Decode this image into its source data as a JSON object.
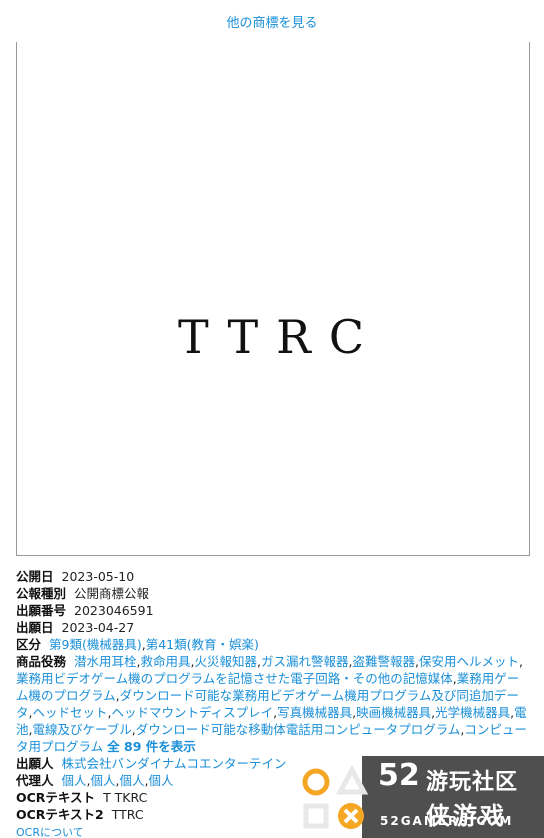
{
  "header": {
    "other_marks_link": "他の商標を見る"
  },
  "mark": {
    "text": "TTRC"
  },
  "details": {
    "pub_date": {
      "label": "公開日",
      "value": "2023-05-10"
    },
    "pub_type": {
      "label": "公報種別",
      "value": "公開商標公報"
    },
    "app_number": {
      "label": "出願番号",
      "value": "2023046591"
    },
    "app_date": {
      "label": "出願日",
      "value": "2023-04-27"
    },
    "classes": {
      "label": "区分",
      "items": [
        "第9類(機械器具)",
        "第41類(教育・娯楽)"
      ]
    },
    "goods": {
      "label": "商品役務",
      "items": [
        "潜水用耳栓",
        "救命用具",
        "火災報知器",
        "ガス漏れ警報器",
        "盗難警報器",
        "保安用ヘルメット",
        "業務用ビデオゲーム機のプログラムを記憶させた電子回路・その他の記憶媒体",
        "業務用ゲーム機のプログラム",
        "ダウンロード可能な業務用ビデオゲーム機用プログラム及び同追加データ",
        "ヘッドセット",
        "ヘッドマウントディスプレイ",
        "写真機械器具",
        "映画機械器具",
        "光学機械器具",
        "電池",
        "電線及びケーブル",
        "ダウンロード可能な移動体電話用コンピュータプログラム",
        "コンピュータ用プログラム"
      ],
      "show_all": "全 89 件を表示"
    },
    "applicant": {
      "label": "出願人",
      "value": "株式会社バンダイナムコエンターテイン"
    },
    "agent": {
      "label": "代理人",
      "items": [
        "個人",
        "個人",
        "個人",
        "個人"
      ]
    },
    "ocr1": {
      "label": "OCRテキスト",
      "value": "T TKRC"
    },
    "ocr2": {
      "label": "OCRテキスト2",
      "value": "TTRC"
    },
    "ocr_about": "OCRについて"
  },
  "watermark": {
    "number": "52",
    "line1": "游玩社区",
    "line2": "侠游戏",
    "url": "52GAMERS.COM"
  }
}
